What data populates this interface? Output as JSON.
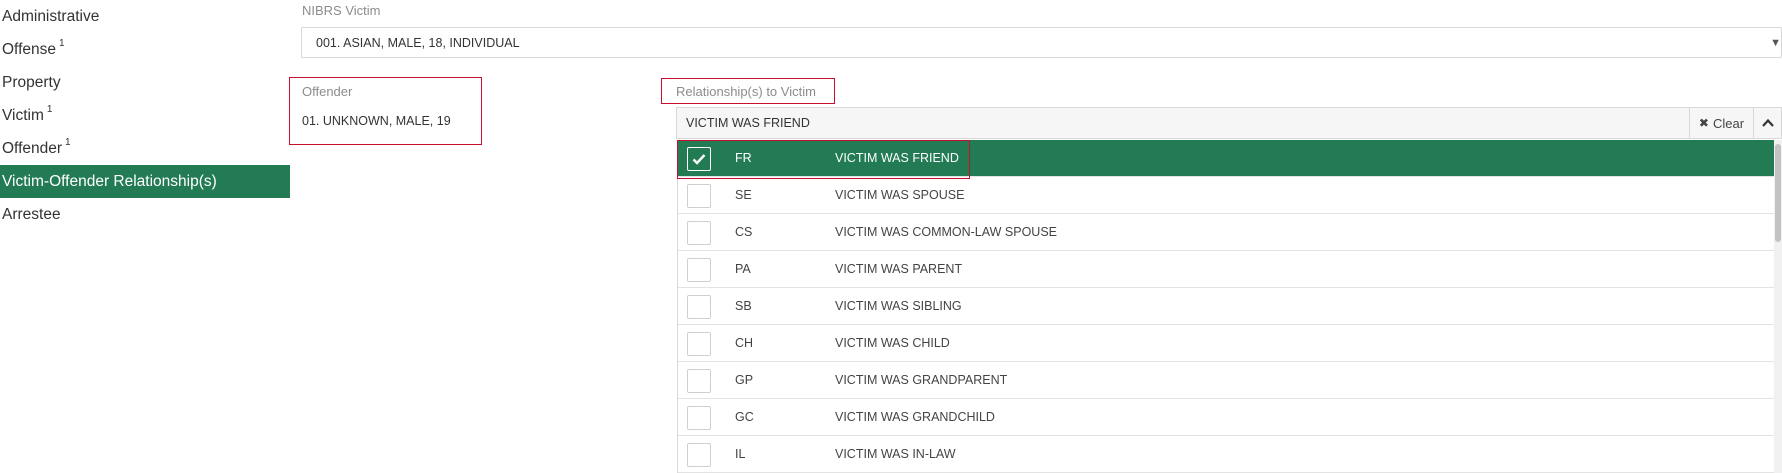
{
  "sidebar": {
    "items": [
      {
        "label": "Administrative",
        "badge": ""
      },
      {
        "label": "Offense",
        "badge": "1"
      },
      {
        "label": "Property",
        "badge": ""
      },
      {
        "label": "Victim",
        "badge": "1"
      },
      {
        "label": "Offender",
        "badge": "1"
      },
      {
        "label": "Victim-Offender Relationship(s)",
        "badge": "",
        "active": true
      },
      {
        "label": "Arrestee",
        "badge": ""
      }
    ]
  },
  "victim": {
    "label": "NIBRS Victim",
    "value": "001. ASIAN, MALE, 18, INDIVIDUAL"
  },
  "offender": {
    "label": "Offender",
    "value": "01. UNKNOWN, MALE, 19"
  },
  "relationship": {
    "label": "Relationship(s) to Victim",
    "value": "VICTIM WAS FRIEND",
    "clear_label": "Clear",
    "options": [
      {
        "code": "FR",
        "desc": "VICTIM WAS FRIEND",
        "checked": true
      },
      {
        "code": "SE",
        "desc": "VICTIM WAS SPOUSE",
        "checked": false
      },
      {
        "code": "CS",
        "desc": "VICTIM WAS COMMON-LAW SPOUSE",
        "checked": false
      },
      {
        "code": "PA",
        "desc": "VICTIM WAS PARENT",
        "checked": false
      },
      {
        "code": "SB",
        "desc": "VICTIM WAS SIBLING",
        "checked": false
      },
      {
        "code": "CH",
        "desc": "VICTIM WAS CHILD",
        "checked": false
      },
      {
        "code": "GP",
        "desc": "VICTIM WAS GRANDPARENT",
        "checked": false
      },
      {
        "code": "GC",
        "desc": "VICTIM WAS GRANDCHILD",
        "checked": false
      },
      {
        "code": "IL",
        "desc": "VICTIM WAS IN-LAW",
        "checked": false
      }
    ]
  },
  "colors": {
    "accent": "#237b53",
    "highlight_border": "#c8102e"
  },
  "icons": {
    "select_caret": "caret-down-icon",
    "clear": "times-icon",
    "collapse": "chevron-up-icon",
    "checkbox_checked": "check-icon"
  }
}
